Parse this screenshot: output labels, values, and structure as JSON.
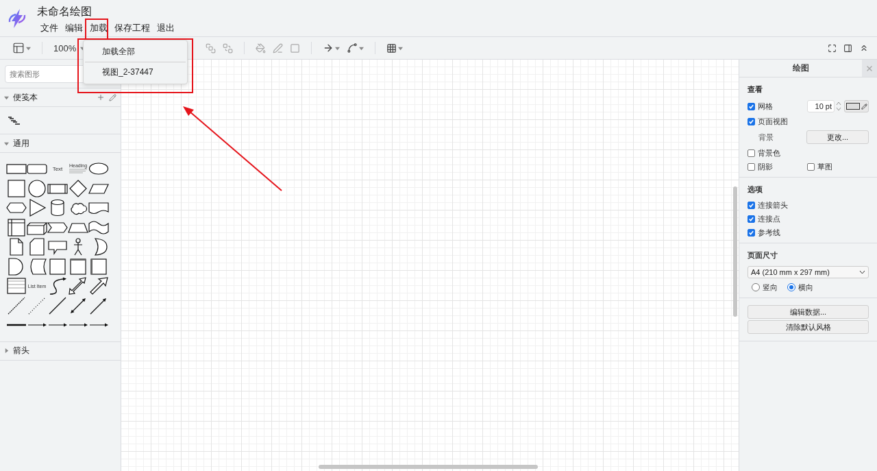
{
  "app": {
    "title": "未命名绘图",
    "menu": [
      "文件",
      "编辑",
      "加载",
      "保存工程",
      "退出"
    ]
  },
  "toolbar": {
    "zoom": "100%"
  },
  "load_menu": {
    "items": [
      "加载全部",
      "视图_2-37447"
    ]
  },
  "sidebar": {
    "search": {
      "placeholder": "搜索图形"
    },
    "sections": [
      {
        "title": "便笺本",
        "expanded": true,
        "kind": "scratchpad"
      },
      {
        "title": "通用",
        "expanded": true,
        "kind": "shapes",
        "shapes": [
          {
            "kind": "rect"
          },
          {
            "kind": "rounded"
          },
          {
            "kind": "text",
            "label": "Text"
          },
          {
            "kind": "heading",
            "label": "Heading"
          },
          {
            "kind": "ellipse"
          },
          {
            "kind": "square"
          },
          {
            "kind": "circle"
          },
          {
            "kind": "process"
          },
          {
            "kind": "diamond"
          },
          {
            "kind": "parallelogram"
          },
          {
            "kind": "hexagon"
          },
          {
            "kind": "triangle"
          },
          {
            "kind": "cylinder"
          },
          {
            "kind": "cloud"
          },
          {
            "kind": "document"
          },
          {
            "kind": "internal"
          },
          {
            "kind": "cube"
          },
          {
            "kind": "step"
          },
          {
            "kind": "trapezoid"
          },
          {
            "kind": "tape"
          },
          {
            "kind": "note"
          },
          {
            "kind": "card"
          },
          {
            "kind": "callout"
          },
          {
            "kind": "actor"
          },
          {
            "kind": "or"
          },
          {
            "kind": "and"
          },
          {
            "kind": "storage"
          },
          {
            "kind": "plain"
          },
          {
            "kind": "frame"
          },
          {
            "kind": "sideframe"
          },
          {
            "kind": "list"
          },
          {
            "kind": "listitem",
            "label": "List Item"
          },
          {
            "kind": "curve"
          },
          {
            "kind": "fatdouble"
          },
          {
            "kind": "fatarrow"
          },
          {
            "kind": "dashed"
          },
          {
            "kind": "dotted"
          },
          {
            "kind": "line"
          },
          {
            "kind": "double"
          },
          {
            "kind": "connector"
          },
          {
            "kind": "thick"
          },
          {
            "kind": "edge"
          },
          {
            "kind": "edge"
          },
          {
            "kind": "edge"
          },
          {
            "kind": "edge"
          }
        ]
      },
      {
        "title": "箭头",
        "expanded": false,
        "kind": "shapes"
      }
    ]
  },
  "format_panel": {
    "tab": "绘图",
    "view": {
      "title": "查看",
      "grid": {
        "label": "网格",
        "checked": true,
        "size": "10 pt"
      },
      "page_view": {
        "label": "页面视图",
        "checked": true
      },
      "background": {
        "label": "背景",
        "button": "更改..."
      },
      "background_color": {
        "label": "背景色",
        "checked": false
      },
      "shadow": {
        "label": "阴影",
        "checked": false
      },
      "sketch": {
        "label": "草图",
        "checked": false
      }
    },
    "options": {
      "title": "选项",
      "items": [
        {
          "label": "连接箭头",
          "checked": true
        },
        {
          "label": "连接点",
          "checked": true
        },
        {
          "label": "参考线",
          "checked": true
        }
      ]
    },
    "page_size": {
      "title": "页面尺寸",
      "value": "A4 (210 mm x 297 mm)",
      "orientation": [
        {
          "label": "竖向",
          "selected": false
        },
        {
          "label": "横向",
          "selected": true
        }
      ]
    },
    "buttons": [
      "编辑数据...",
      "清除默认风格"
    ]
  }
}
